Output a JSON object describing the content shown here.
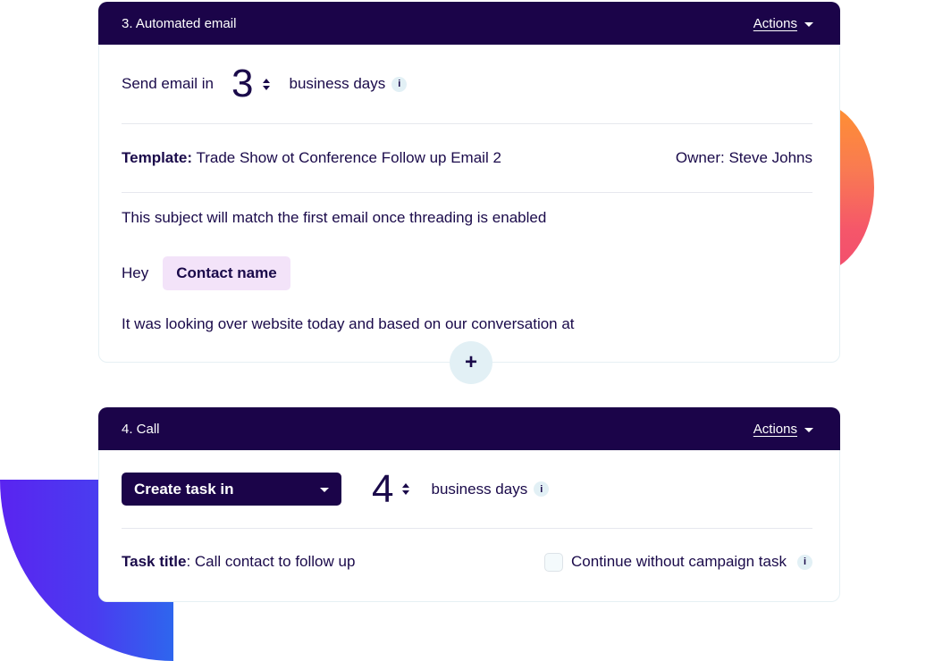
{
  "colors": {
    "header_bg": "#1b0449",
    "text": "#1a0a4a",
    "chip_bg": "#f3e3f9",
    "info_bg": "#e2f0f5",
    "deco_orange_top": "#ff9130",
    "deco_orange_bottom": "#f24e6e",
    "deco_blue_left": "#5a24f0",
    "deco_blue_right": "#2e66ee"
  },
  "step3": {
    "title": "3. Automated email",
    "actions_label": "Actions",
    "send_prefix": "Send email in",
    "days_value": "3",
    "days_suffix": "business days",
    "info_icon": "i",
    "template_label": "Template:",
    "template_value": "Trade Show ot Conference Follow up Email 2",
    "owner": "Owner: Steve Johns",
    "subject_note": "This subject will match the first email once threading is enabled",
    "greeting": "Hey",
    "contact_chip": "Contact name",
    "body_line": "It was looking over website today and based on our conversation at",
    "add_icon": "+"
  },
  "step4": {
    "title": "4. Call",
    "actions_label": "Actions",
    "select_value": "Create task in",
    "days_value": "4",
    "days_suffix": "business days",
    "info_icon": "i",
    "task_title_label": "Task title",
    "task_title_value": ": Call contact to follow up",
    "continue_label": "Continue without campaign task",
    "continue_checked": false
  }
}
